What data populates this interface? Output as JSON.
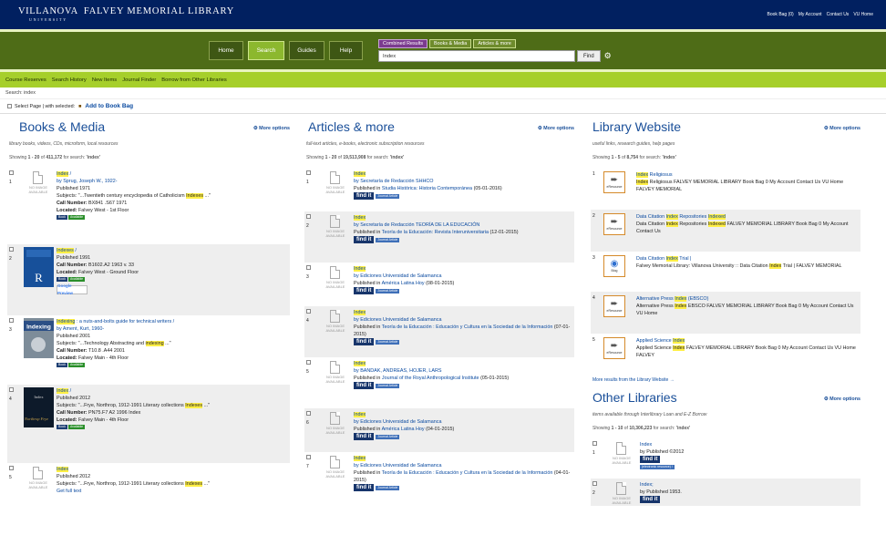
{
  "brand": {
    "university": "VILLANOVA",
    "university_sub": "UNIVERSITY",
    "library": "FALVEY MEMORIAL LIBRARY"
  },
  "top_links": [
    "Book Bag (0)",
    "My Account",
    "Contact Us",
    "VU Home"
  ],
  "nav": {
    "buttons": [
      "Home",
      "Search",
      "Guides",
      "Help"
    ],
    "active": "Search"
  },
  "search": {
    "tabs": [
      "Combined Results",
      "Books & Media",
      "Articles & more"
    ],
    "active_tab": "Combined Results",
    "value": "Index",
    "find_label": "Find"
  },
  "subnav": [
    "Course Reserves",
    "Search History",
    "New Items",
    "Journal Finder",
    "Borrow from Other Libraries"
  ],
  "breadcrumb": "Search: index",
  "toolbar": {
    "select_label": "Select Page | with selected:",
    "bookbag_label": "Add to Book Bag"
  },
  "more_options": "More options",
  "books": {
    "title": "Books & Media",
    "desc": "library books, videos, CDs, microform, local resources",
    "showing": {
      "pre": "Showing ",
      "range": "1 - 20",
      "of": " of ",
      "total": "411,172",
      "post": " for search: ",
      "term": "'index'"
    },
    "items": [
      {
        "n": "1",
        "title_hl": "Index",
        "title_rest": " /",
        "by": "by Sprug, Joseph W., 1922-",
        "published": "Published 1971",
        "subjects_pre": "Subjects: \"...Twentieth century encyclopedia of Catholicism ",
        "subjects_hl": "Indexes",
        "subjects_post": " ...\"",
        "call": "BX841 .S67 1971",
        "located": "Falvey West - 1st Floor",
        "badges": [
          "Book",
          "Available"
        ]
      },
      {
        "n": "2",
        "title_hl": "Indexes",
        "title_rest": " /",
        "published": "Published 1991",
        "call": "B1602.A2 1963 v. 33",
        "located": "Falvey West - Ground Floor",
        "badges": [
          "Book",
          "Available"
        ],
        "google": "Google Preview"
      },
      {
        "n": "3",
        "title_hl": "Indexing",
        "title_rest": " : a nuts-and-bolts guide for technical writers /",
        "by": "by Ament, Kurt, 1960-",
        "published": "Published 2001",
        "subjects_pre": "Subjects: \"...Technology Abstracting and ",
        "subjects_hl": "indexing",
        "subjects_post": " ...\"",
        "call": "T10.8 .A44 2001",
        "located": "Falvey Main - 4th Floor",
        "badges": [
          "Book",
          "Available"
        ],
        "cover_text": "Indexing"
      },
      {
        "n": "4",
        "title_hl": "Index",
        "title_rest": " /",
        "published": "Published 2012",
        "subjects_pre": "Subjects: \"...Frye, Northrop, 1912-1991 Literary collections ",
        "subjects_hl": "Indexes",
        "subjects_post": " ...\"",
        "call": "PN75.F7 A2 1996 Index",
        "located": "Falvey Main - 4th Floor",
        "badges": [
          "Book",
          "Available"
        ],
        "cover_text": "Index"
      },
      {
        "n": "5",
        "title_hl": "Index",
        "published": "Published 2012",
        "subjects_pre": "Subjects: \"...Frye, Northrop, 1912-1991 Literary collections ",
        "subjects_hl": "Indexes",
        "subjects_post": " ...\"",
        "fulltext": "Get full text"
      }
    ]
  },
  "articles": {
    "title": "Articles & more",
    "desc": "full-text articles, e-books, electronic subscription resources",
    "showing": {
      "pre": "Showing ",
      "range": "1 - 20",
      "of": " of ",
      "total": "19,513,908",
      "post": " for search: ",
      "term": "'index'"
    },
    "find_it": "find it",
    "journal": "Journal Article",
    "items": [
      {
        "n": "1",
        "title": "Index",
        "by": "by Secretaría de Redacción SHHCO",
        "pub_pre": "Published in ",
        "pub_link": "Studia Histórica: Historia Contemporánea",
        "pub_date": "(05-01-2016)"
      },
      {
        "n": "2",
        "title": "Index",
        "by": "by Secretaría de Redacción TEORÍA DE LA EDUCACIÓN",
        "pub_pre": "Published in ",
        "pub_link": "Teoría de la Educación: Revista Interuniversitaria",
        "pub_date": "(12-01-2015)"
      },
      {
        "n": "3",
        "title": "Index",
        "by": "by Ediciones Universidad de Salamanca",
        "pub_pre": "Published in ",
        "pub_link": "América Latina Hoy",
        "pub_date": "(08-01-2015)"
      },
      {
        "n": "4",
        "title": "Index",
        "by": "by Ediciones Universidad de Salamanca",
        "pub_pre": "Published in ",
        "pub_link": "Teoría de la Educación : Educación y Cultura en la Sociedad de la Información",
        "pub_date": "(07-01-2015)"
      },
      {
        "n": "5",
        "title": "Index",
        "by": "by BANDAK, ANDREAS, HOJER, LARS",
        "pub_pre": "Published in ",
        "pub_link": "Journal of the Royal Anthropological Institute",
        "pub_date": "(05-01-2015)"
      },
      {
        "n": "6",
        "title": "Index",
        "by": "by Ediciones Universidad de Salamanca",
        "pub_pre": "Published in ",
        "pub_link": "América Latina Hoy",
        "pub_date": "(04-01-2015)"
      },
      {
        "n": "7",
        "title": "Index",
        "by": "by Ediciones Universidad de Salamanca",
        "pub_pre": "Published in ",
        "pub_link": "Teoría de la Educación : Educación y Cultura en la Sociedad de la Información",
        "pub_date": "(04-01-2015)"
      }
    ]
  },
  "website": {
    "title": "Library Website",
    "desc": "useful links, research guides, help pages",
    "showing": {
      "pre": "Showing ",
      "range": "1 - 5",
      "of": " of ",
      "total": "8,754",
      "post": " for search: ",
      "term": "'index'"
    },
    "items": [
      {
        "n": "1",
        "icon": "eResource",
        "title_pre": "",
        "title_hl": "Index",
        "title_post": " Religiosus",
        "snip_pre": "",
        "snip_hl": "Index",
        "snip_post": " Religiosus FALVEY MEMORIAL LIBRARY Book Bag 0 My Account Contact Us VU Home FALVEY MEMORIAL"
      },
      {
        "n": "2",
        "icon": "eResource",
        "title_pre": "Data Citation ",
        "title_hl": "Index",
        "title_post": " Repositories ",
        "title_hl2": "Indexed",
        "snip_pre": "Data Citation ",
        "snip_hl": "Index",
        "snip_post": " Repositories ",
        "snip_hl2": "Indexed",
        "snip_post2": " FALVEY MEMORIAL LIBRARY Book Bag 0 My Account Contact Us"
      },
      {
        "n": "3",
        "icon": "Blog",
        "title_pre": "Data Citation ",
        "title_hl": "Index",
        "title_post": " Trial |",
        "snip_pre": "Falvey Memorial Library: Villanova University :: Data Citation ",
        "snip_hl": "Index",
        "snip_post": " Trial | FALVEY MEMORIAL"
      },
      {
        "n": "4",
        "icon": "eResource",
        "title_pre": "Alternative Press ",
        "title_hl": "Index",
        "title_post": " (EBSCO)",
        "snip_pre": "Alternative Press ",
        "snip_hl": "Index",
        "snip_post": " EBSCO FALVEY MEMORIAL LIBRARY Book Bag 0 My Account Contact Us VU Home"
      },
      {
        "n": "5",
        "icon": "eResource",
        "title_pre": "Applied Science ",
        "title_hl": "Index",
        "title_post": "",
        "snip_pre": "Applied Science ",
        "snip_hl": "Index",
        "snip_post": " FALVEY MEMORIAL LIBRARY Book Bag 0 My Account Contact Us VU Home FALVEY"
      }
    ],
    "more_results": "More results from the Library Website →"
  },
  "other": {
    "title": "Other Libraries",
    "desc": "items available through Interlibrary Loan and E-Z Borrow",
    "showing": {
      "pre": "Showing ",
      "range": "1 - 10",
      "of": " of ",
      "total": "10,306,223",
      "post": " for search: ",
      "term": "'index'"
    },
    "items": [
      {
        "n": "1",
        "title": "Index",
        "published": "by Published ©2012",
        "tag": "(electronic resource) /"
      },
      {
        "n": "2",
        "title": "Index;",
        "published": "by Published 1953."
      }
    ]
  },
  "no_image": [
    "NO IMAGE",
    "AVAILABLE"
  ],
  "colors": {
    "navy": "#012060",
    "olive": "#4e6c17",
    "lime": "#a6cf2b",
    "purple": "#7b3b8f",
    "highlight": "#ffef45",
    "link": "#0a4aa0"
  }
}
